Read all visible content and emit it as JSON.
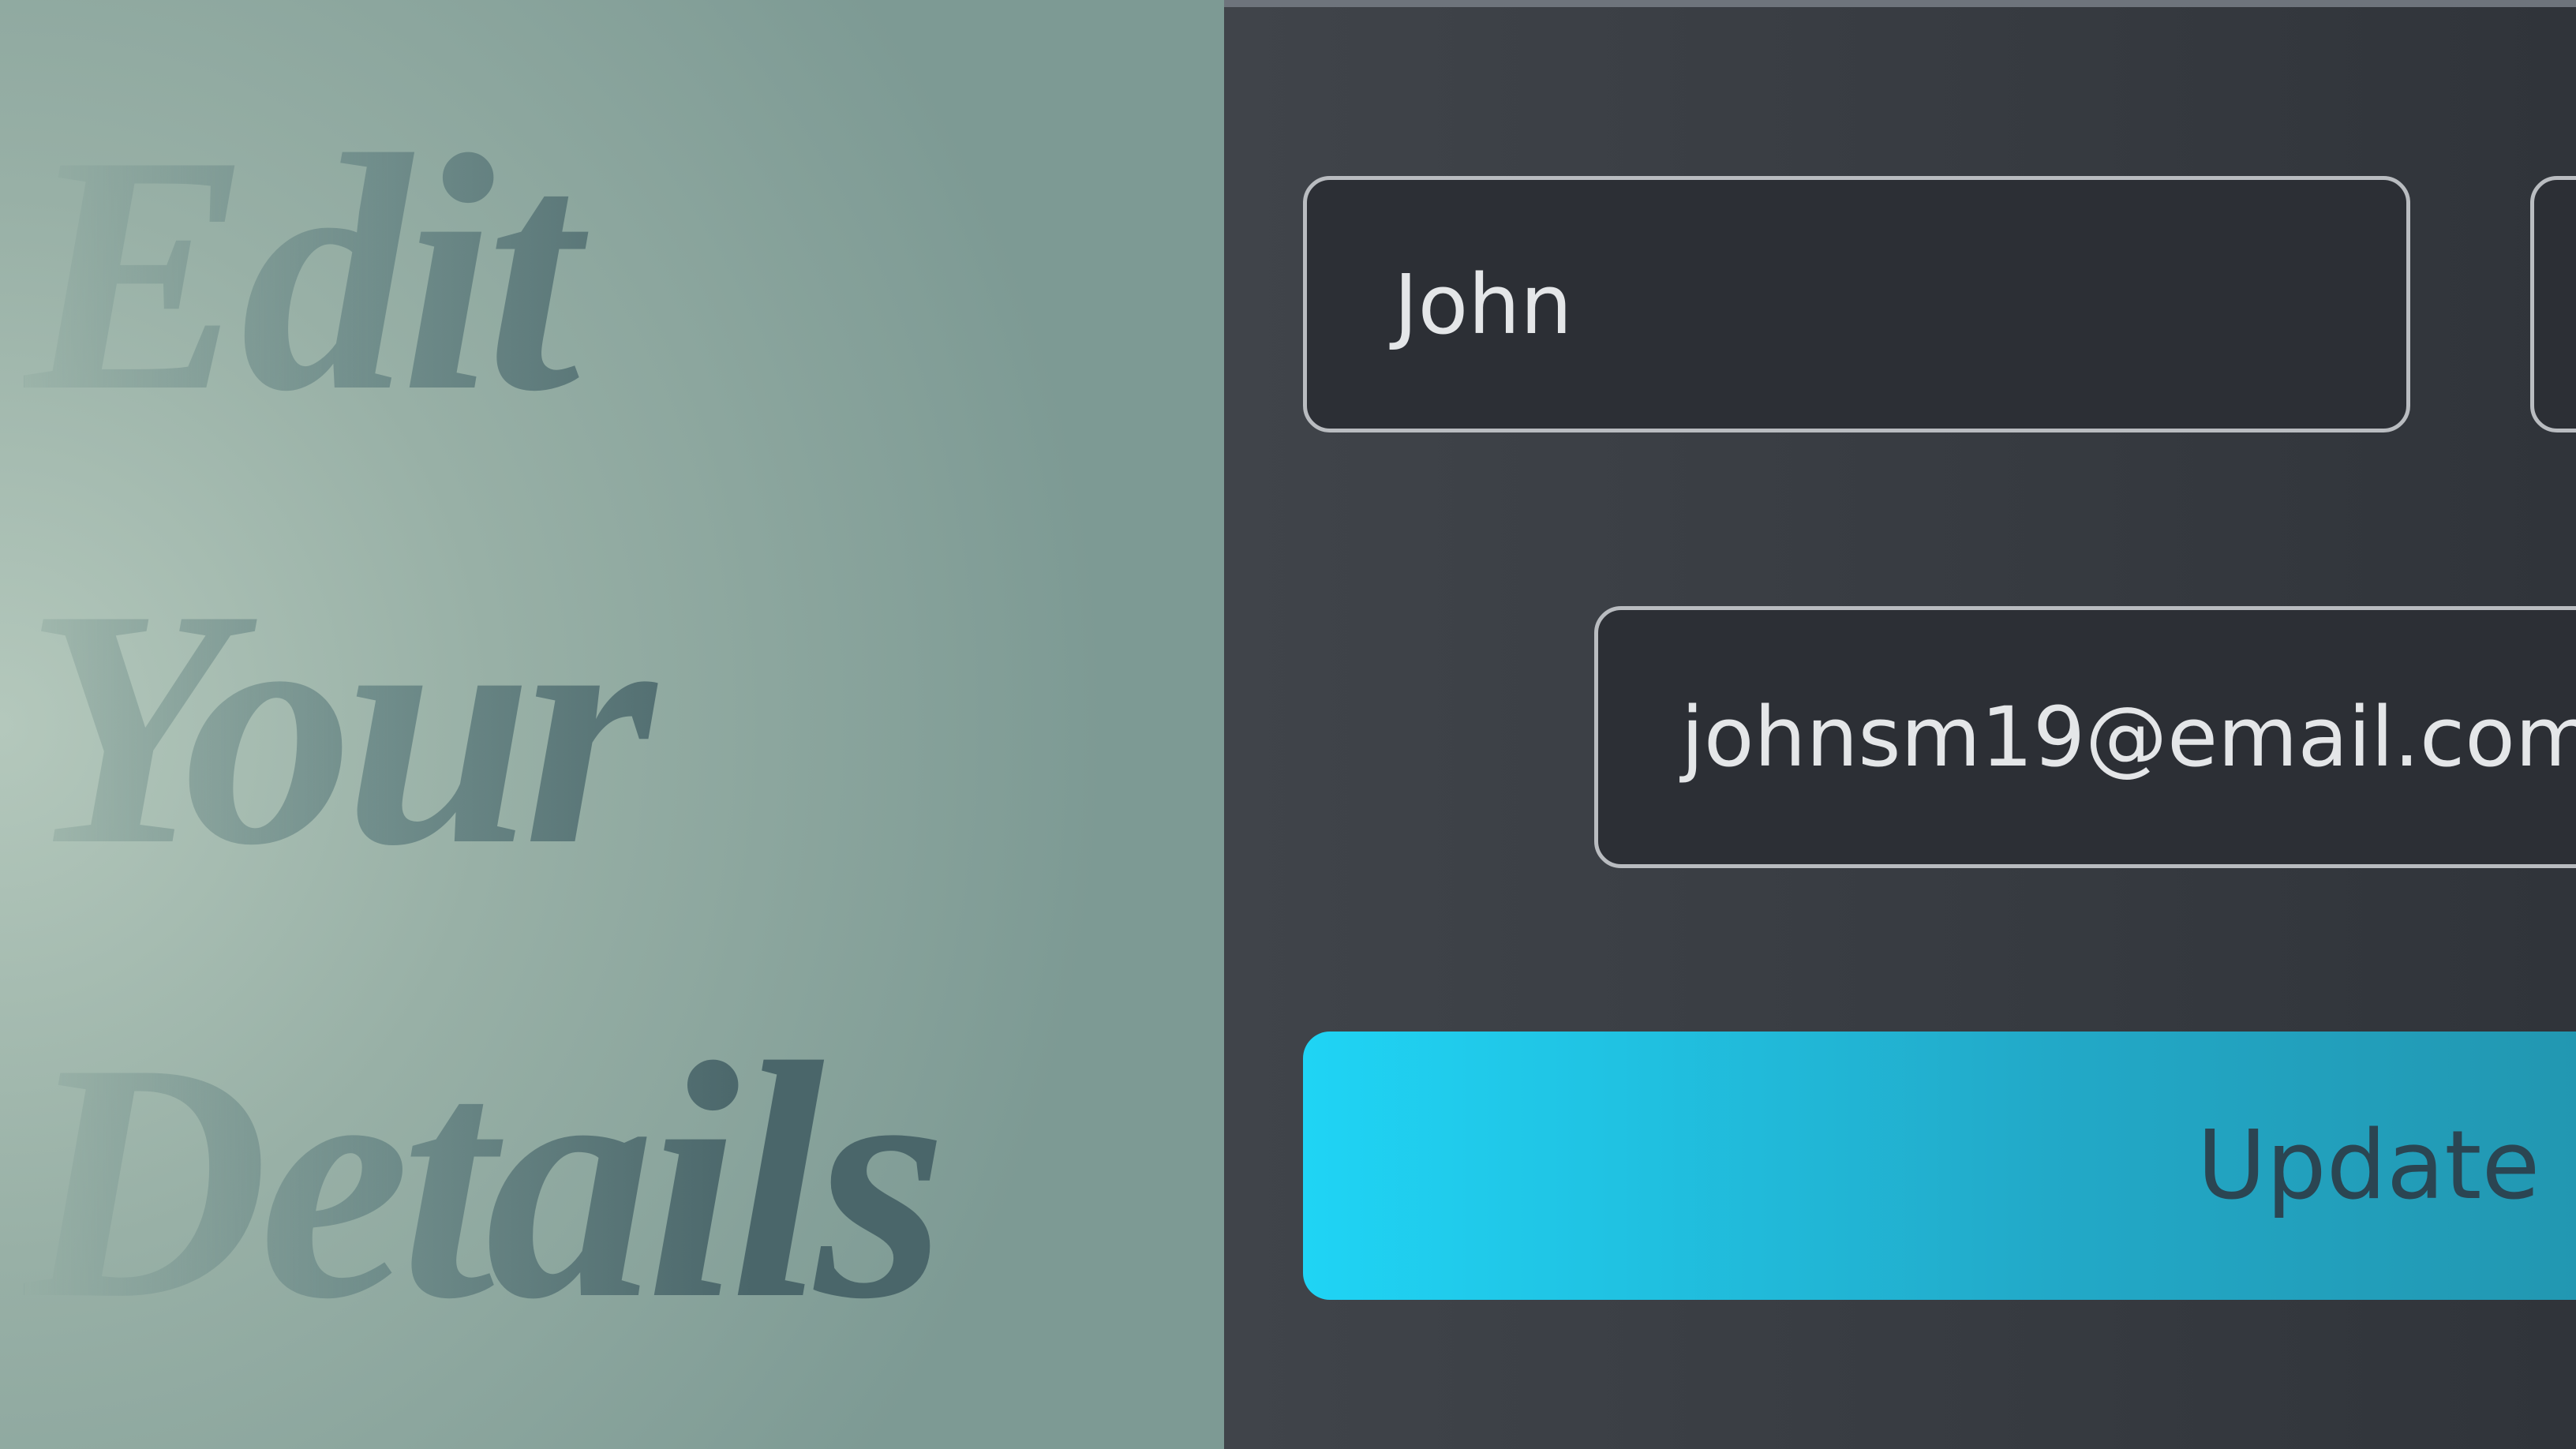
{
  "heading": {
    "line1": "Edit",
    "line2": "Your",
    "line3": "Details"
  },
  "form": {
    "first_name": "John",
    "last_name": "",
    "email": "johnsm19@email.com",
    "submit_label": "Update"
  },
  "colors": {
    "accent_start": "#1fd4f5",
    "accent_end": "#217a8c",
    "panel": "#34383e"
  }
}
